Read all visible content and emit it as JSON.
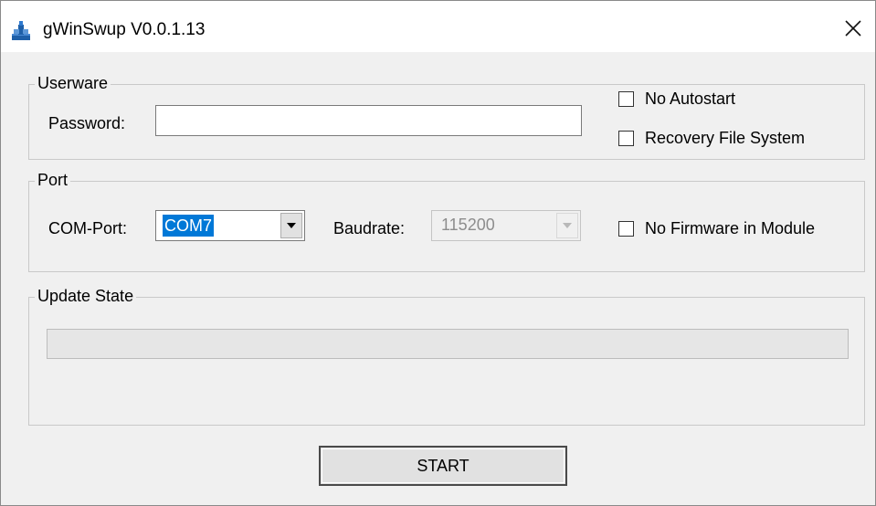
{
  "window": {
    "title": "gWinSwup V0.0.1.13"
  },
  "icons": {
    "app": "gripper-arm-icon",
    "close": "close-x-icon",
    "dropdown": "chevron-down-icon"
  },
  "userware": {
    "legend": "Userware",
    "password_label": "Password:",
    "password_value": "",
    "no_autostart_label": "No Autostart",
    "no_autostart_checked": false,
    "recovery_label": "Recovery File System",
    "recovery_checked": false
  },
  "port": {
    "legend": "Port",
    "com_label": "COM-Port:",
    "com_value": "COM7",
    "baud_label": "Baudrate:",
    "baud_value": "115200",
    "no_firmware_label": "No Firmware in Module",
    "no_firmware_checked": false
  },
  "update_state": {
    "legend": "Update State",
    "progress": 0
  },
  "start_button": {
    "label": "START"
  }
}
